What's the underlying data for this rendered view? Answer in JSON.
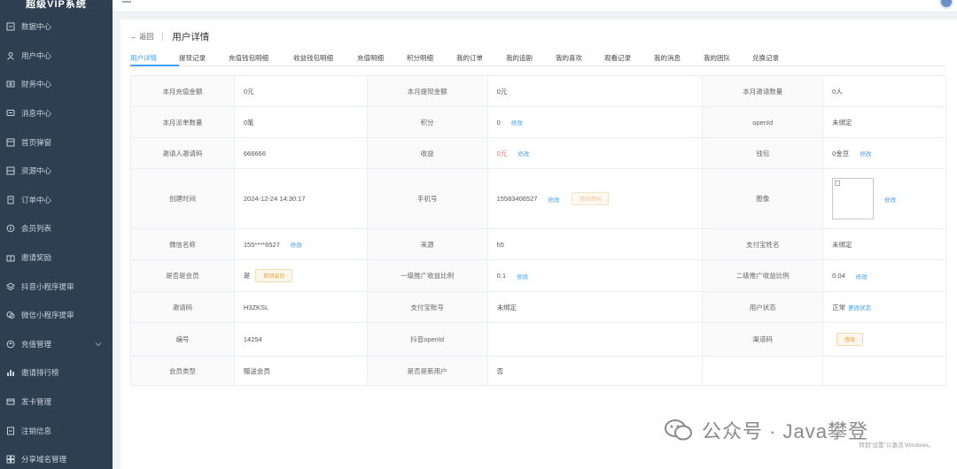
{
  "sidebar": {
    "brand": "超级VIP系统",
    "items": [
      {
        "label": "数据中心",
        "icon": "data-icon"
      },
      {
        "label": "用户中心",
        "icon": "user-icon"
      },
      {
        "label": "财务中心",
        "icon": "finance-icon"
      },
      {
        "label": "消息中心",
        "icon": "message-icon"
      },
      {
        "label": "首页弹窗",
        "icon": "popup-icon"
      },
      {
        "label": "资源中心",
        "icon": "resource-icon"
      },
      {
        "label": "订单中心",
        "icon": "order-icon"
      },
      {
        "label": "会员列表",
        "icon": "member-icon"
      },
      {
        "label": "邀请奖励",
        "icon": "gift-icon"
      },
      {
        "label": "抖音小程序提审",
        "icon": "layers-icon"
      },
      {
        "label": "微信小程序提审",
        "icon": "wechat-icon"
      },
      {
        "label": "充值管理",
        "icon": "recharge-icon",
        "expandable": true
      },
      {
        "label": "邀请排行榜",
        "icon": "rank-icon"
      },
      {
        "label": "发卡管理",
        "icon": "card-icon"
      },
      {
        "label": "注销信息",
        "icon": "logout-icon"
      },
      {
        "label": "分享域名管理",
        "icon": "domain-icon"
      }
    ]
  },
  "breadcrumb": {
    "back": "← 返回",
    "title": "用户详情"
  },
  "tabs": [
    "用户详情",
    "提现记录",
    "充值钱包明细",
    "收益钱包明细",
    "充值明细",
    "积分明细",
    "我的订单",
    "我的追剧",
    "我的喜欢",
    "观看记录",
    "我的消息",
    "我的团队",
    "兑换记录"
  ],
  "details": {
    "r1": {
      "l1": "本月充值金额",
      "v1": "0元",
      "l2": "本月提现金额",
      "v2": "0元",
      "l3": "本月邀请数量",
      "v3": "0人"
    },
    "r2": {
      "l1": "本月派单数量",
      "v1": "0笔",
      "l2": "积分",
      "v2": "0",
      "l3": "openId",
      "v3": "未绑定"
    },
    "r3": {
      "l1": "邀请人邀请码",
      "v1": "666666",
      "l2": "收益",
      "v2": "0元",
      "l3": "钱包",
      "v3": "0金豆"
    },
    "r4": {
      "l1": "创建时间",
      "v1": "2024-12-24 14:30:17",
      "l2": "手机号",
      "v2": "15583406527",
      "l3": "图像"
    },
    "r5": {
      "l1": "微信名称",
      "v1": "155****6527",
      "l2": "来源",
      "v2": "h5",
      "l3": "支付宝姓名",
      "v3": "未绑定"
    },
    "r6": {
      "l1": "是否是会员",
      "v1": "是",
      "l2": "一级推广收益比例",
      "v2": "0.1",
      "l3": "二级推广收益比例",
      "v3": "0.04"
    },
    "r7": {
      "l1": "邀请码",
      "v1": "H3ZKSL",
      "l2": "支付宝账号",
      "v2": "未绑定",
      "l3": "用户状态",
      "v3": "正常"
    },
    "r8": {
      "l1": "编号",
      "v1": "14254",
      "l2": "抖音openId",
      "v2": "",
      "l3": "渠道码"
    },
    "r9": {
      "l1": "会员类型",
      "v1": "赠送会员",
      "l2": "是否是新用户",
      "v2": "否"
    }
  },
  "actions": {
    "edit": "修改",
    "change_phone": "修改密码",
    "cancel_member": "取消会员",
    "change_status": "更改状态"
  },
  "watermark": {
    "text": "公众号 · Java攀登",
    "windows": "转到\"设置\"以激活 Windows。"
  }
}
